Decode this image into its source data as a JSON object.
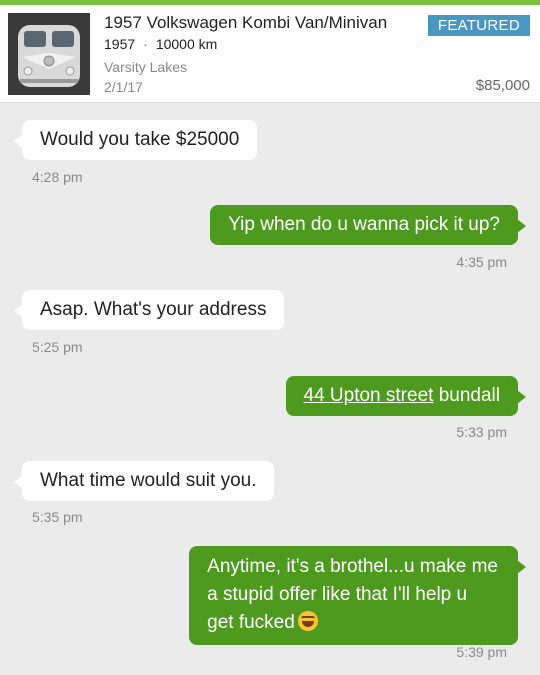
{
  "listing": {
    "title": "1957 Volkswagen Kombi Van/Minivan",
    "year": "1957",
    "mileage": "10000 km",
    "location": "Varsity Lakes",
    "date": "2/1/17",
    "badge": "FEATURED",
    "price": "$85,000",
    "separator": "·"
  },
  "messages": [
    {
      "direction": "in",
      "text": "Would you take $25000",
      "time": "4:28 pm"
    },
    {
      "direction": "out",
      "text": "Yip when do u wanna pick it up?",
      "time": "4:35 pm"
    },
    {
      "direction": "in",
      "text": "Asap. What's your address",
      "time": "5:25 pm"
    },
    {
      "direction": "out",
      "link_text": "44 Upton street",
      "text_after": " bundall",
      "time": "5:33 pm"
    },
    {
      "direction": "in",
      "text": "What time would suit you.",
      "time": "5:35 pm"
    },
    {
      "direction": "out",
      "text_lines": [
        "Anytime, it's a brothel...u make me",
        "a stupid offer like that I'll help u",
        "get fucked"
      ],
      "emoji": "laughing-emoji",
      "time": "5:39 pm"
    }
  ],
  "colors": {
    "accent_green": "#7cc142",
    "bubble_out": "#4d9a1f",
    "badge_blue": "#4a97c2",
    "background": "#ebebeb"
  }
}
